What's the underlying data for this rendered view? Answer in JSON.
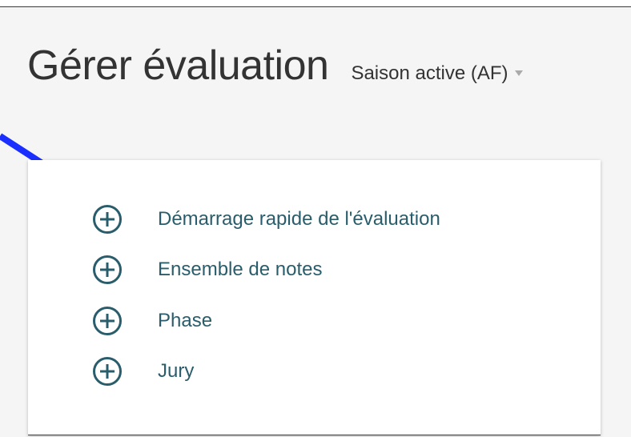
{
  "header": {
    "title": "Gérer évaluation",
    "season_selector": {
      "selected": "Saison active (AF)",
      "icon": "caret-down-icon"
    }
  },
  "menu": {
    "items": [
      {
        "label": "Démarrage rapide de l'évaluation",
        "icon": "plus-circle-icon"
      },
      {
        "label": "Ensemble de notes",
        "icon": "plus-circle-icon"
      },
      {
        "label": "Phase",
        "icon": "plus-circle-icon"
      },
      {
        "label": "Jury",
        "icon": "plus-circle-icon"
      }
    ]
  },
  "annotation": {
    "icon": "pointer-arrow-icon",
    "color": "#1a2fff"
  },
  "colors": {
    "accent": "#2a5d6b",
    "background": "#f5f5f5",
    "panel": "#ffffff"
  }
}
